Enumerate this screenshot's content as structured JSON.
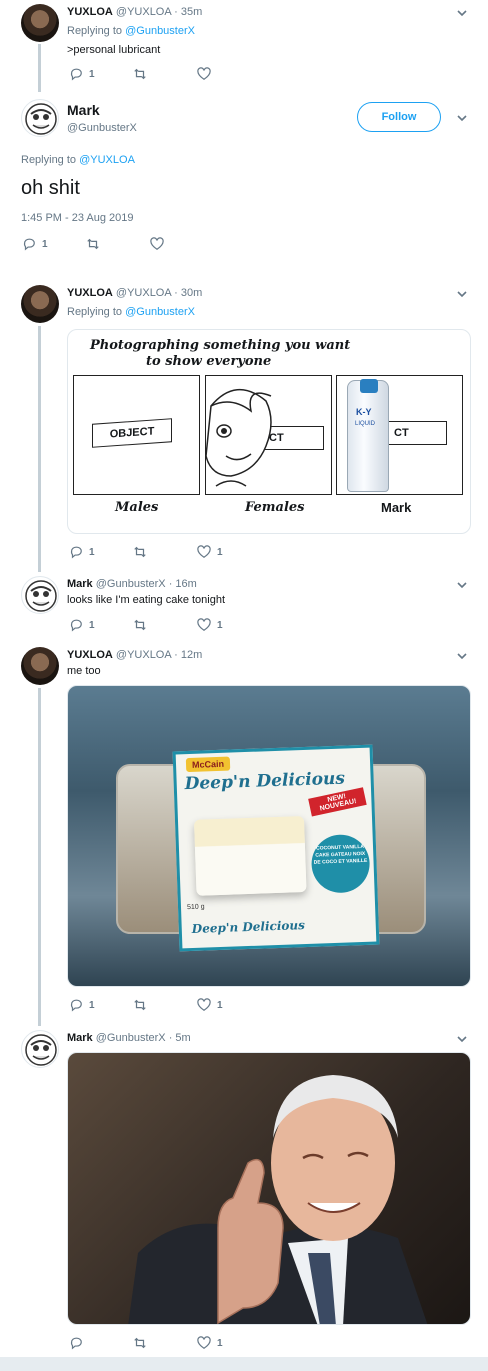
{
  "tweets": [
    {
      "name": "YUXLOA",
      "handle": "@YUXLOA",
      "time": "· 35m",
      "replying_prefix": "Replying to",
      "replying_to": "@GunbusterX",
      "text": ">personal lubricant",
      "replies": "1",
      "retweets": "",
      "likes": ""
    },
    {
      "name": "Mark",
      "handle": "@GunbusterX",
      "follow_label": "Follow",
      "replying_prefix": "Replying to",
      "replying_to": "@YUXLOA",
      "text": "oh shit",
      "timestamp": "1:45 PM - 23 Aug 2019",
      "replies": "1"
    },
    {
      "name": "YUXLOA",
      "handle": "@YUXLOA",
      "time": "· 30m",
      "replying_prefix": "Replying to",
      "replying_to": "@GunbusterX",
      "meme": {
        "title_line1": "Photographing something you want",
        "title_line2": "to show everyone",
        "object_label": "OBJECT",
        "panel1": "Males",
        "panel2": "Females",
        "panel3": "Mark",
        "bottle_brand": "K-Y",
        "bottle_sub": "LIQUID"
      },
      "replies": "1",
      "likes": "1"
    },
    {
      "name": "Mark",
      "handle": "@GunbusterX",
      "time": "· 16m",
      "text": "looks like I'm eating cake tonight",
      "replies": "1",
      "likes": "1"
    },
    {
      "name": "YUXLOA",
      "handle": "@YUXLOA",
      "time": "· 12m",
      "text": "me too",
      "cake": {
        "brand": "McCain",
        "product": "Deep'n Delicious",
        "badge": "NEW! NOUVEAU!",
        "flavor": "COCONUT VANILLA CAKE GATEAU NOIX DE COCO ET VANILLE",
        "weight": "510 g"
      },
      "replies": "1",
      "likes": "1"
    },
    {
      "name": "Mark",
      "handle": "@GunbusterX",
      "time": "· 5m",
      "likes": "1"
    }
  ],
  "colors": {
    "accent": "#1da1f2",
    "muted": "#657786",
    "thread_line": "#c4cfd6"
  },
  "icons": [
    "reply-icon",
    "retweet-icon",
    "like-icon",
    "chevron-down-icon"
  ]
}
